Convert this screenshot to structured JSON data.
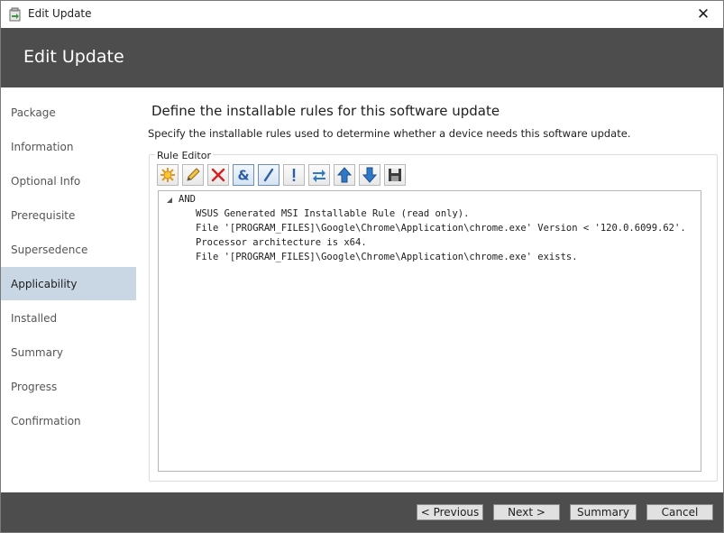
{
  "window": {
    "title": "Edit Update",
    "close_symbol": "✕",
    "icon": "wizard-app-icon"
  },
  "header": {
    "title": "Edit Update"
  },
  "sidebar": {
    "items": [
      {
        "label": "Package",
        "active": false
      },
      {
        "label": "Information",
        "active": false
      },
      {
        "label": "Optional Info",
        "active": false
      },
      {
        "label": "Prerequisite",
        "active": false
      },
      {
        "label": "Supersedence",
        "active": false
      },
      {
        "label": "Applicability",
        "active": true
      },
      {
        "label": "Installed",
        "active": false
      },
      {
        "label": "Summary",
        "active": false
      },
      {
        "label": "Progress",
        "active": false
      },
      {
        "label": "Confirmation",
        "active": false
      }
    ]
  },
  "main": {
    "title": "Define the installable rules for this software update",
    "description": "Specify the installable rules used to determine whether a device needs this software update.",
    "rule_editor": {
      "label": "Rule Editor",
      "toolbar": [
        {
          "icon": "new-rule-icon"
        },
        {
          "icon": "edit-pencil-icon"
        },
        {
          "icon": "delete-icon"
        },
        {
          "icon": "and-ampersand-icon"
        },
        {
          "icon": "or-slash-icon"
        },
        {
          "icon": "not-exclamation-icon"
        },
        {
          "icon": "swap-arrows-icon"
        },
        {
          "icon": "move-up-arrow-icon"
        },
        {
          "icon": "move-down-arrow-icon"
        },
        {
          "icon": "save-disk-icon"
        }
      ],
      "tree": {
        "root": "AND",
        "rules": [
          "WSUS Generated MSI Installable Rule (read only).",
          "File '[PROGRAM_FILES]\\Google\\Chrome\\Application\\chrome.exe' Version < '120.0.6099.62'.",
          "Processor architecture is x64.",
          "File '[PROGRAM_FILES]\\Google\\Chrome\\Application\\chrome.exe' exists."
        ]
      }
    }
  },
  "footer": {
    "previous": "< Previous",
    "next": "Next >",
    "summary": "Summary",
    "cancel": "Cancel"
  },
  "colors": {
    "header_bg": "#4d4d4d",
    "active_nav_bg": "#c9d6e3",
    "footer_bg": "#4d4d4d"
  }
}
